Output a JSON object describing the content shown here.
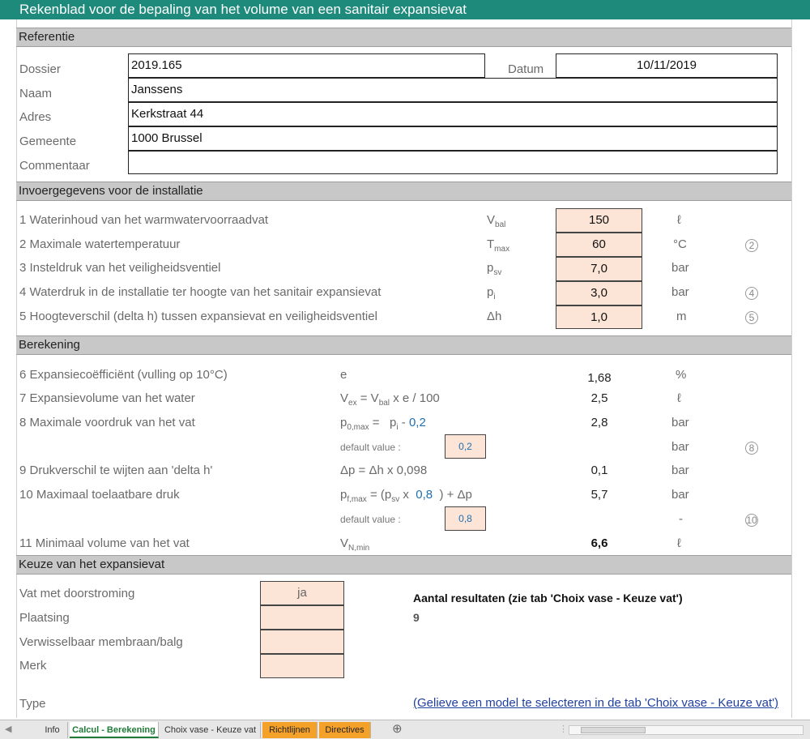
{
  "title": "Rekenblad voor de bepaling van het volume van een sanitair expansievat",
  "referentie": {
    "heading": "Referentie",
    "dossier_label": "Dossier",
    "dossier": "2019.165",
    "datum_label": "Datum",
    "datum": "10/11/2019",
    "naam_label": "Naam",
    "naam": "Janssens",
    "adres_label": "Adres",
    "adres": "Kerkstraat 44",
    "gemeente_label": "Gemeente",
    "gemeente": "1000 Brussel",
    "commentaar_label": "Commentaar",
    "commentaar": ""
  },
  "invoer": {
    "heading": "Invoergegevens voor de installatie",
    "rows": [
      {
        "label": "1 Waterinhoud van het warmwatervoorraadvat",
        "sym": "V",
        "sub": "bal",
        "value": "150",
        "unit": "ℓ",
        "note": ""
      },
      {
        "label": "2 Maximale watertemperatuur",
        "sym": "T",
        "sub": "max",
        "value": "60",
        "unit": "°C",
        "note": "2"
      },
      {
        "label": "3 Insteldruk van het veiligheidsventiel",
        "sym": "p",
        "sub": "sv",
        "value": "7,0",
        "unit": "bar",
        "note": ""
      },
      {
        "label": "4 Waterdruk in de installatie ter hoogte van het sanitair expansievat",
        "sym": "p",
        "sub": "i",
        "value": "3,0",
        "unit": "bar",
        "note": "4"
      },
      {
        "label": "5 Hoogteverschil (delta h) tussen expansievat en veiligheidsventiel",
        "sym": "Δh",
        "sub": "",
        "value": "1,0",
        "unit": "m",
        "note": "5"
      }
    ]
  },
  "berekening": {
    "heading": "Berekening",
    "r6_label": "6 Expansiecoëfficiënt (vulling op 10°C)",
    "r6_sym": "e",
    "r6_val": "1,68",
    "r6_unit": "%",
    "r7_label": "7 Expansievolume van het water",
    "r7_val": "2,5",
    "r7_unit": "ℓ",
    "r8_label": "8 Maximale voordruk van het vat",
    "r8_factor": "0,2",
    "r8_val": "2,8",
    "r8_unit": "bar",
    "default_label": "default value :",
    "default8": "0,2",
    "default8_unit": "bar",
    "default8_note": "8",
    "r9_label": "9 Drukverschil te wijten aan 'delta h'",
    "r9_formula": "Δp = Δh x 0,098",
    "r9_val": "0,1",
    "r9_unit": "bar",
    "r10_label": "10 Maximaal toelaatbare druk",
    "r10_factor": "0,8",
    "r10_val": "5,7",
    "r10_unit": "bar",
    "default10": "0,8",
    "default10_unit": "-",
    "default10_note": "10",
    "r11_label": "11 Minimaal volume van het vat",
    "r11_val": "6,6",
    "r11_unit": "ℓ"
  },
  "keuze": {
    "heading": "Keuze van het expansievat",
    "doorstroming_label": "Vat met doorstroming",
    "doorstroming": "ja",
    "plaatsing_label": "Plaatsing",
    "plaatsing": "",
    "membraan_label": "Verwisselbaar membraan/balg",
    "membraan": "",
    "merk_label": "Merk",
    "merk": "",
    "aantal_label": "Aantal resultaten (zie tab 'Choix vase - Keuze vat')",
    "aantal": "9",
    "type_label": "Type",
    "type_link": "(Gelieve een model te selecteren in de tab 'Choix vase - Keuze vat')"
  },
  "tabs": [
    {
      "label": "Info",
      "state": "normal"
    },
    {
      "label": "Calcul - Berekening",
      "state": "active"
    },
    {
      "label": "Choix vase - Keuze vat",
      "state": "normal"
    },
    {
      "label": "Richtlijnen",
      "state": "orange"
    },
    {
      "label": "Directives",
      "state": "orange"
    }
  ],
  "colors": {
    "title_bar": "#1e8a7c",
    "input_fill": "#fce4d6",
    "section_fill": "#c8c8c8",
    "link": "#1f3f9e",
    "tab_orange": "#f4a12a"
  }
}
